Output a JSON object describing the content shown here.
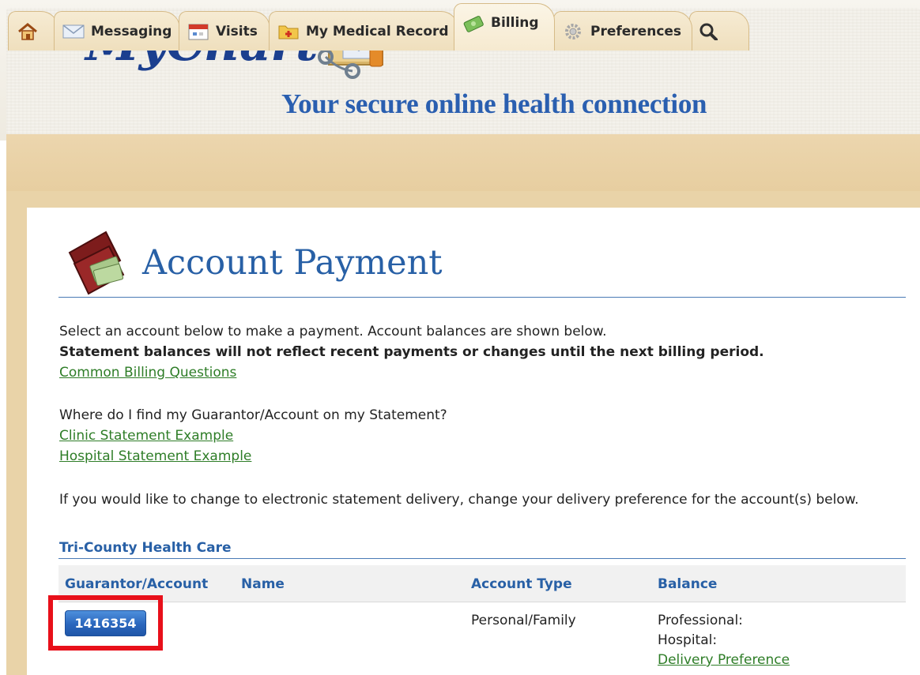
{
  "app": {
    "logo_text": "MyChart",
    "tagline": "Your secure online health connection"
  },
  "tabs": [
    {
      "label": "",
      "icon": "home-icon"
    },
    {
      "label": "Messaging",
      "icon": "envelope-icon"
    },
    {
      "label": "Visits",
      "icon": "calendar-icon"
    },
    {
      "label": "My Medical Record",
      "icon": "medical-folder-icon"
    },
    {
      "label": "Billing",
      "icon": "money-icon",
      "active": true
    },
    {
      "label": "Preferences",
      "icon": "gear-icon"
    },
    {
      "label": "",
      "icon": "search-icon"
    }
  ],
  "page": {
    "title": "Account Payment",
    "intro": "Select an account below to make a payment.  Account balances are shown below.",
    "notice": "Statement balances will not reflect recent payments or changes until the next billing period.",
    "faq_link": "Common Billing Questions",
    "where_question": "Where do I find my Guarantor/Account on my Statement?",
    "clinic_link": "Clinic Statement Example",
    "hospital_link": "Hospital Statement Example",
    "electronic_note": "If you would like to change to electronic statement delivery, change your delivery preference for the account(s) below."
  },
  "accounts_section": {
    "title": "Tri-County Health Care",
    "columns": [
      "Guarantor/Account",
      "Name",
      "Account Type",
      "Balance"
    ],
    "rows": [
      {
        "account": "1416354",
        "name": "",
        "type": "Personal/Family",
        "balance_professional_label": "Professional:",
        "balance_hospital_label": "Hospital:",
        "delivery_link": "Delivery Preference"
      }
    ]
  },
  "colors": {
    "brand_blue": "#2860a6",
    "link_green": "#2e7d27",
    "highlight_red": "#e8101a",
    "tab_tan": "#e9d3a8"
  }
}
